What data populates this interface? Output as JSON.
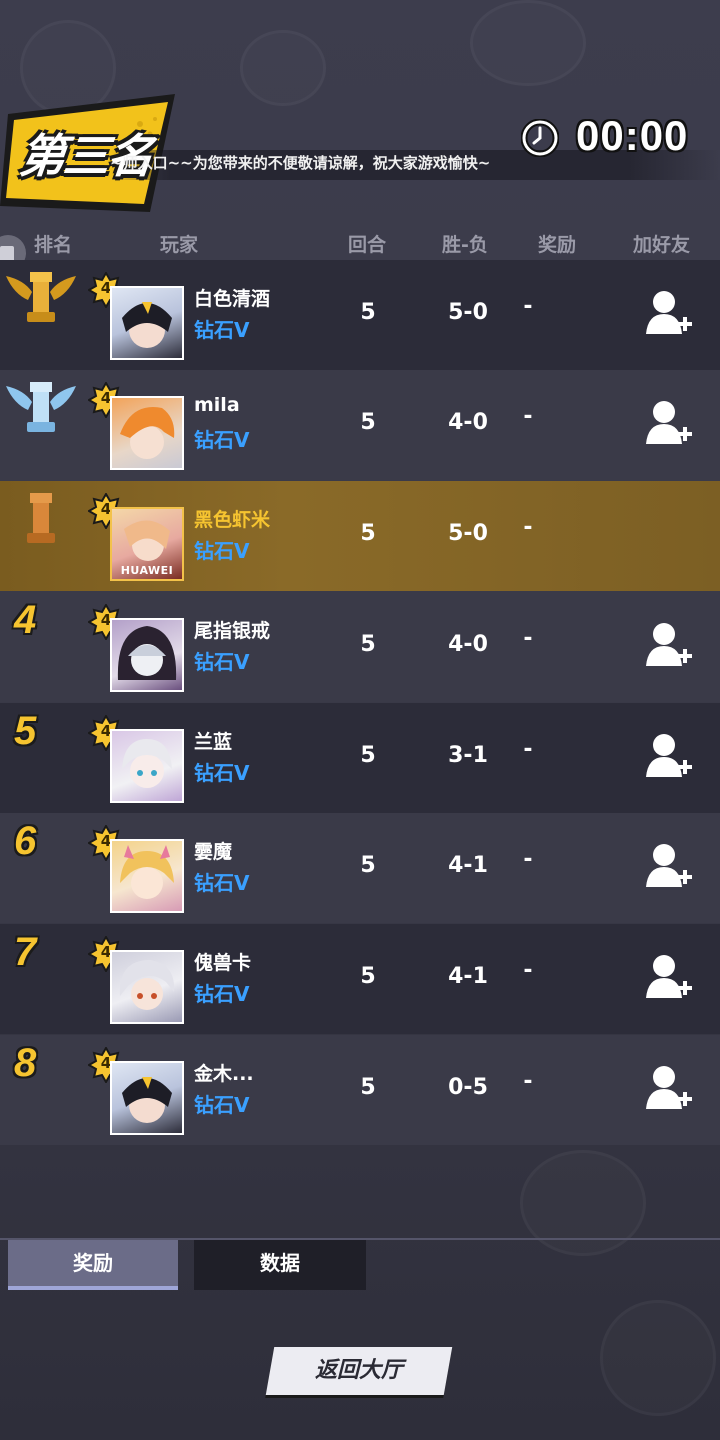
{
  "header": {
    "rank_title": "第三名",
    "marquee": "~师入口~~为您带来的不便敬请谅解，祝大家游戏愉快~",
    "timer": "00:00"
  },
  "columns": [
    "排名",
    "玩家",
    "回合",
    "胜-负",
    "奖励",
    "加好友"
  ],
  "rows": [
    {
      "rank": "1",
      "trophy": "gold-trophy-icon",
      "level": "4",
      "name": "白色清酒",
      "tier": "钻石V",
      "rounds": "5",
      "wl": "5-0",
      "reward": "-"
    },
    {
      "rank": "2",
      "trophy": "silver-trophy-icon",
      "level": "4",
      "name": "mila",
      "tier": "钻石V",
      "rounds": "5",
      "wl": "4-0",
      "reward": "-"
    },
    {
      "rank": "3",
      "trophy": "bronze-trophy-icon",
      "level": "4",
      "name": "黑色虾米",
      "tier": "钻石V",
      "rounds": "5",
      "wl": "5-0",
      "reward": "-",
      "avatar_caption": "HUAWEI"
    },
    {
      "rank": "4",
      "level": "4",
      "name": "尾指银戒",
      "tier": "钻石V",
      "rounds": "5",
      "wl": "4-0",
      "reward": "-"
    },
    {
      "rank": "5",
      "level": "4",
      "name": "兰蓝",
      "tier": "钻石V",
      "rounds": "5",
      "wl": "3-1",
      "reward": "-"
    },
    {
      "rank": "6",
      "level": "4",
      "name": "孁魔",
      "tier": "钻石V",
      "rounds": "5",
      "wl": "4-1",
      "reward": "-"
    },
    {
      "rank": "7",
      "level": "4",
      "name": "傀兽卡",
      "tier": "钻石V",
      "rounds": "5",
      "wl": "4-1",
      "reward": "-"
    },
    {
      "rank": "8",
      "level": "4",
      "name": "金木...",
      "tier": "钻石V",
      "rounds": "5",
      "wl": "0-5",
      "reward": "-"
    }
  ],
  "tabs": {
    "reward": "奖励",
    "data": "数据"
  },
  "back_button": "返回大厅",
  "colors": {
    "gold": "#f6c430",
    "tier_blue": "#3aa0ff",
    "highlight": "#7a5c1f",
    "banner_yellow": "#f2c21b"
  }
}
